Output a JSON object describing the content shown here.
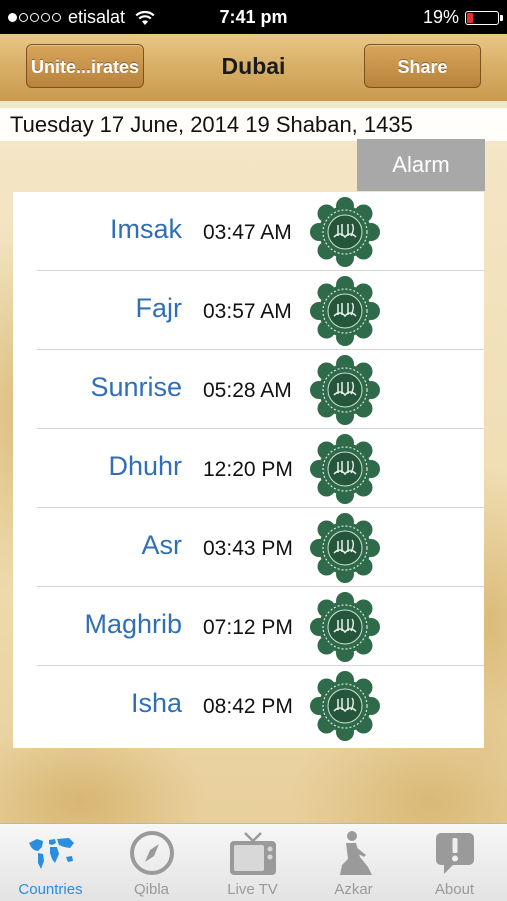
{
  "status_bar": {
    "carrier": "etisalat",
    "time": "7:41 pm",
    "battery": "19%",
    "battery_level": 0.19
  },
  "nav": {
    "left_button": "Unite...irates",
    "title": "Dubai",
    "right_button": "Share"
  },
  "date_line": "Tuesday 17 June, 2014 19 Shaban, 1435",
  "alarm_button": "Alarm",
  "prayers": [
    {
      "name": "Imsak",
      "time": "03:47 AM"
    },
    {
      "name": "Fajr",
      "time": "03:57 AM"
    },
    {
      "name": "Sunrise",
      "time": "05:28 AM"
    },
    {
      "name": "Dhuhr",
      "time": "12:20 PM"
    },
    {
      "name": "Asr",
      "time": "03:43 PM"
    },
    {
      "name": "Maghrib",
      "time": "07:12 PM"
    },
    {
      "name": "Isha",
      "time": "08:42 PM"
    }
  ],
  "tabs": [
    {
      "label": "Countries",
      "icon": "globe-icon",
      "active": true
    },
    {
      "label": "Qibla",
      "icon": "compass-icon",
      "active": false
    },
    {
      "label": "Live TV",
      "icon": "tv-icon",
      "active": false
    },
    {
      "label": "Azkar",
      "icon": "prayer-person-icon",
      "active": false
    },
    {
      "label": "About",
      "icon": "info-bubble-icon",
      "active": false
    }
  ],
  "colors": {
    "prayer_name": "#2f6fb8",
    "tab_active": "#2a8de0",
    "tab_inactive": "#9a9a9a",
    "alarm_bg": "#a8a8a8",
    "emblem_green": "#2f6a4a"
  }
}
